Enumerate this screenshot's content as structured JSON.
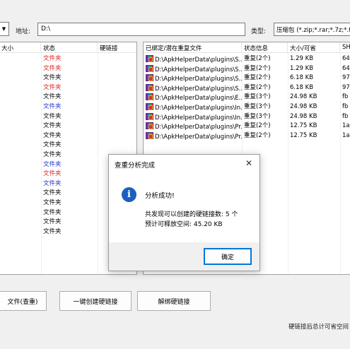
{
  "topbar": {
    "combo_arrow": "▼",
    "address_label": "地址:",
    "address_value": "D:\\",
    "type_label": "类型:",
    "type_value": "压缩包 (*.zip;*.rar;*.7z;*.tar;"
  },
  "left_table": {
    "headers": [
      "大小",
      "状态",
      "硬链接"
    ],
    "rows": [
      {
        "status": "文件夹",
        "color": "#e02020"
      },
      {
        "status": "文件夹",
        "color": "#e02020"
      },
      {
        "status": "文件夹",
        "color": "#000000"
      },
      {
        "status": "文件夹",
        "color": "#e02020"
      },
      {
        "status": "文件夹",
        "color": "#000000"
      },
      {
        "status": "文件夹",
        "color": "#1c33c8"
      },
      {
        "status": "文件夹",
        "color": "#000000"
      },
      {
        "status": "文件夹",
        "color": "#000000"
      },
      {
        "status": "文件夹",
        "color": "#000000"
      },
      {
        "status": "文件夹",
        "color": "#000000"
      },
      {
        "status": "文件夹",
        "color": "#000000"
      },
      {
        "status": "文件夹",
        "color": "#1c33c8"
      },
      {
        "status": "文件夹",
        "color": "#e02020"
      },
      {
        "status": "文件夹",
        "color": "#1c33c8"
      },
      {
        "status": "文件夹",
        "color": "#000000"
      },
      {
        "status": "文件夹",
        "color": "#000000"
      },
      {
        "status": "文件夹",
        "color": "#000000"
      },
      {
        "status": "文件夹",
        "color": "#000000"
      },
      {
        "status": "文件夹",
        "color": "#000000"
      }
    ]
  },
  "right_table": {
    "headers": [
      "已绑定/潜在重复文件",
      "状态信息",
      "大小/可省",
      "SH"
    ],
    "rows": [
      {
        "path": "D:\\ApkHelperData\\plugins\\S...",
        "status": "重复(2个)",
        "size": "1.29 KB",
        "hash": "64"
      },
      {
        "path": "D:\\ApkHelperData\\plugins\\S...",
        "status": "重复(2个)",
        "size": "1.29 KB",
        "hash": "64"
      },
      {
        "path": "D:\\ApkHelperData\\plugins\\S...",
        "status": "重复(2个)",
        "size": "6.18 KB",
        "hash": "97"
      },
      {
        "path": "D:\\ApkHelperData\\plugins\\S...",
        "status": "重复(2个)",
        "size": "6.18 KB",
        "hash": "97"
      },
      {
        "path": "D:\\ApkHelperData\\plugins\\E...",
        "status": "重复(3个)",
        "size": "24.98 KB",
        "hash": "fb"
      },
      {
        "path": "D:\\ApkHelperData\\plugins\\In...",
        "status": "重复(3个)",
        "size": "24.98 KB",
        "hash": "fb"
      },
      {
        "path": "D:\\ApkHelperData\\plugins\\In...",
        "status": "重复(3个)",
        "size": "24.98 KB",
        "hash": "fb"
      },
      {
        "path": "D:\\ApkHelperData\\plugins\\Pr...",
        "status": "重复(2个)",
        "size": "12.75 KB",
        "hash": "1a"
      },
      {
        "path": "D:\\ApkHelperData\\plugins\\Pr...",
        "status": "重复(2个)",
        "size": "12.75 KB",
        "hash": "1a"
      }
    ]
  },
  "buttons": {
    "find_dup": "文件(查重)",
    "create_links": "一键创建硬链接",
    "remove_links": "解绑硬链接"
  },
  "status_bar": {
    "text": "硬链接后总计可省空间"
  },
  "dialog": {
    "title": "查重分析完成",
    "close": "✕",
    "icon": "i",
    "message": "分析成功!",
    "line1": "共发现可以创建的硬链接数: 5 个",
    "line2": "预计可释放空间: 45.20 KB",
    "ok": "确定"
  },
  "colors": {
    "dialog_accent": "#0078d7",
    "info_icon": "#1c5fbe",
    "red_status": "#e02020",
    "blue_status": "#1c33c8"
  }
}
